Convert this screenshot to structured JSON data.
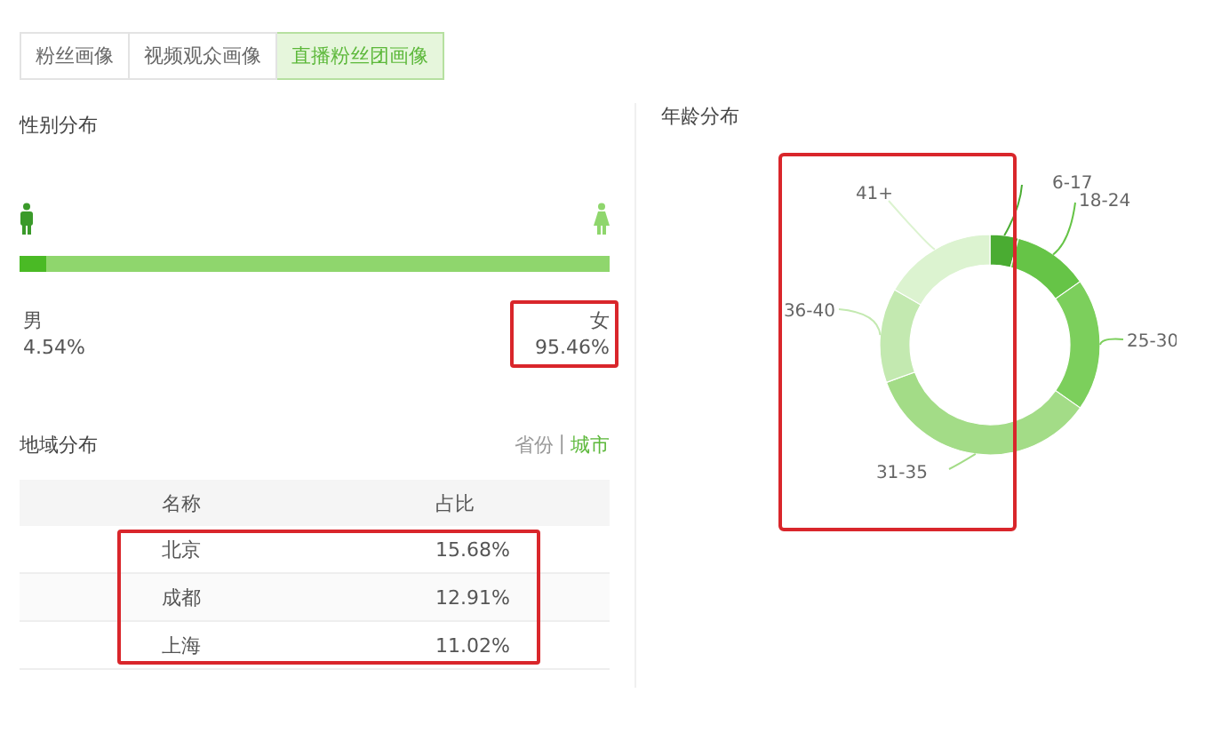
{
  "tabs": [
    {
      "label": "粉丝画像",
      "selected": false
    },
    {
      "label": "视频观众画像",
      "selected": false
    },
    {
      "label": "直播粉丝团画像",
      "selected": true
    }
  ],
  "gender": {
    "title": "性别分布",
    "level": 0.0454,
    "male": {
      "label": "男",
      "value": "4.54%",
      "highlighted": false
    },
    "female": {
      "label": "女",
      "value": "95.46%",
      "highlighted": true
    }
  },
  "region": {
    "title": "地域分布",
    "toggle": [
      {
        "label": "省份",
        "selected": false
      },
      {
        "label": "城市",
        "selected": true
      }
    ],
    "separator": "|",
    "columns": [
      "名称",
      "占比"
    ],
    "rows": [
      {
        "name": "北京",
        "share": "15.68%"
      },
      {
        "name": "成都",
        "share": "12.91%"
      },
      {
        "name": "上海",
        "share": "11.02%"
      }
    ],
    "rows_highlighted": true
  },
  "age": {
    "title": "年龄分布",
    "highlighted": true,
    "segments": [
      {
        "label": "6-17",
        "color": "#4aac32"
      },
      {
        "label": "18-24",
        "color": "#66c447"
      },
      {
        "label": "25-30",
        "color": "#7ccf5c"
      },
      {
        "label": "31-35",
        "color": "#a3dc87"
      },
      {
        "label": "36-40",
        "color": "#c3e9b0"
      },
      {
        "label": "41+",
        "color": "#dcf3d0"
      }
    ]
  }
}
